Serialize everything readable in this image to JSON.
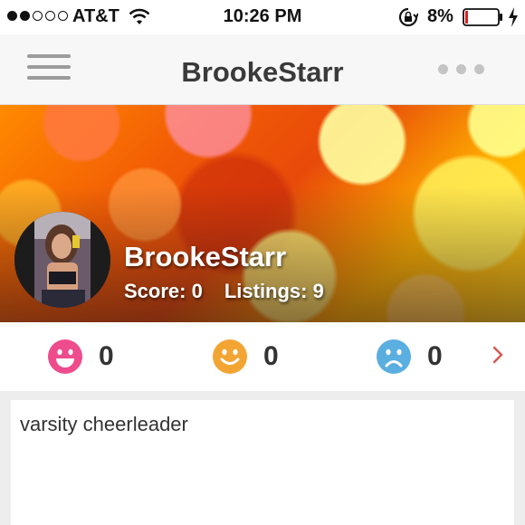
{
  "status_bar": {
    "carrier": "AT&T",
    "signal_bars_filled": 2,
    "signal_bars_total": 5,
    "time": "10:26 PM",
    "battery_percent": "8%",
    "battery_level": 0.08,
    "icons": [
      "wifi-icon",
      "rotation-lock-icon",
      "battery-icon",
      "charging-icon"
    ]
  },
  "nav": {
    "title": "BrookeStarr",
    "left_icon": "hamburger-menu-icon",
    "right_icon": "more-dots-icon"
  },
  "profile": {
    "name": "BrookeStarr",
    "score_text": "Score: 0",
    "listings_text": "Listings: 9"
  },
  "ratings": [
    {
      "icon": "laughing-face-icon",
      "color": "#ee4c8c",
      "count": "0"
    },
    {
      "icon": "smiling-face-icon",
      "color": "#f3a533",
      "count": "0"
    },
    {
      "icon": "sad-face-icon",
      "color": "#5aaee0",
      "count": "0"
    }
  ],
  "ratings_more_icon": "chevron-right-icon",
  "accent_color": "#d9534f",
  "description": "varsity cheerleader"
}
